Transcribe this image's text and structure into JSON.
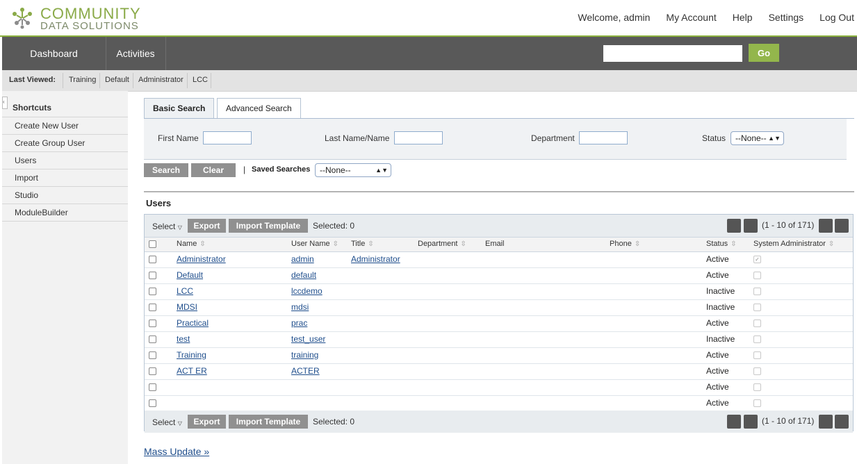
{
  "brand": {
    "line1": "COMMUNITY",
    "line2": "DATA SOLUTIONS"
  },
  "header": {
    "welcome": "Welcome, admin",
    "links": [
      "My Account",
      "Help",
      "Settings",
      "Log Out"
    ]
  },
  "nav": {
    "tabs": [
      "Dashboard",
      "Activities"
    ],
    "search_value": "",
    "go_label": "Go"
  },
  "last_viewed": {
    "label": "Last Viewed:",
    "items": [
      "Training",
      "Default",
      "Administrator",
      "LCC"
    ]
  },
  "sidebar": {
    "title": "Shortcuts",
    "items": [
      "Create New User",
      "Create Group User",
      "Users",
      "Import",
      "Studio",
      "ModuleBuilder"
    ]
  },
  "search": {
    "tabs": [
      "Basic Search",
      "Advanced Search"
    ],
    "fields": {
      "first_name": "First Name",
      "last_name": "Last Name/Name",
      "department": "Department",
      "status": "Status"
    },
    "status_value": "--None--",
    "search_label": "Search",
    "clear_label": "Clear",
    "saved_searches_label": "Saved Searches",
    "saved_searches_value": "--None--"
  },
  "users": {
    "heading": "Users",
    "toolbar": {
      "select": "Select",
      "export": "Export",
      "import_template": "Import Template",
      "selected": "Selected: 0",
      "pagination": "(1 - 10 of 171)"
    },
    "columns": [
      "Name",
      "User Name",
      "Title",
      "Department",
      "Email",
      "Phone",
      "Status",
      "System Administrator"
    ],
    "rows": [
      {
        "name": "Administrator",
        "username": "admin",
        "title": "Administrator",
        "status": "Active",
        "sysadmin": true
      },
      {
        "name": "Default",
        "username": "default",
        "title": "",
        "status": "Active",
        "sysadmin": false
      },
      {
        "name": "LCC",
        "username": "lccdemo",
        "title": "",
        "status": "Inactive",
        "sysadmin": false
      },
      {
        "name": "MDSI",
        "username": "mdsi",
        "title": "",
        "status": "Inactive",
        "sysadmin": false
      },
      {
        "name": "Practical",
        "username": "prac",
        "title": "",
        "status": "Active",
        "sysadmin": false
      },
      {
        "name": "test",
        "username": "test_user",
        "title": "",
        "status": "Inactive",
        "sysadmin": false
      },
      {
        "name": "Training",
        "username": "training",
        "title": "",
        "status": "Active",
        "sysadmin": false
      },
      {
        "name": "ACT ER",
        "username": "ACTER",
        "title": "",
        "status": "Active",
        "sysadmin": false
      },
      {
        "name": "",
        "username": "",
        "title": "",
        "status": "Active",
        "sysadmin": false
      },
      {
        "name": "",
        "username": "",
        "title": "",
        "status": "Active",
        "sysadmin": false
      }
    ],
    "mass_update": "Mass Update »"
  },
  "colors": {
    "accent_green": "#93b64c",
    "nav_bg": "#595959",
    "link": "#1f4e8c"
  }
}
